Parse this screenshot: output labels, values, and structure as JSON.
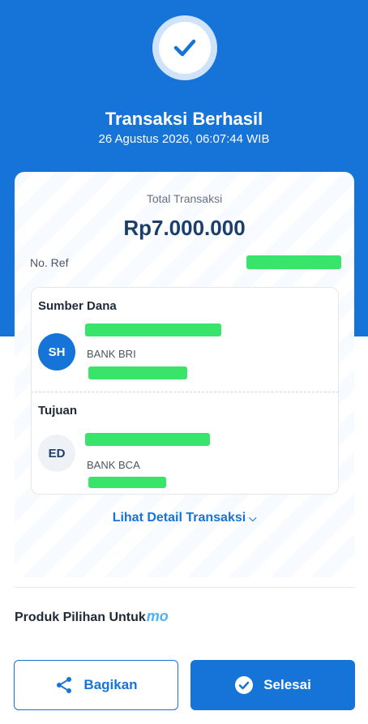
{
  "hero": {
    "title": "Transaksi Berhasil",
    "datetime": "26 Agustus 2026, 06:07:44 WIB",
    "icon": "checkmark-icon"
  },
  "receipt": {
    "total_label": "Total Transaksi",
    "total_amount": "Rp7.000.000",
    "ref_label": "No. Ref"
  },
  "source": {
    "title": "Sumber Dana",
    "initials": "SH",
    "bank": "BANK BRI"
  },
  "destination": {
    "title": "Tujuan",
    "initials": "ED",
    "bank": "BANK BCA"
  },
  "detail_link": {
    "label": "Lihat Detail Transaksi"
  },
  "products": {
    "title": "Produk Pilihan Untuk",
    "brand": "mo"
  },
  "actions": {
    "share_label": "Bagikan",
    "done_label": "Selesai"
  },
  "colors": {
    "primary": "#1674d8",
    "redaction": "#39e46b",
    "amount": "#1b3f6a"
  }
}
